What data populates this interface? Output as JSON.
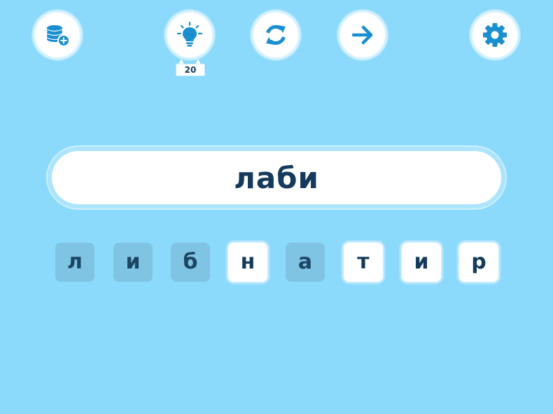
{
  "toolbar": {
    "buttons": [
      {
        "id": "coins",
        "icon": "coins-plus-icon"
      },
      {
        "id": "hint",
        "icon": "lightbulb-icon",
        "badge": "20"
      },
      {
        "id": "shuffle",
        "icon": "refresh-icon"
      },
      {
        "id": "next",
        "icon": "arrow-right-icon"
      },
      {
        "id": "settings",
        "icon": "gear-icon"
      }
    ]
  },
  "answer": {
    "text": "лаби"
  },
  "letters": [
    {
      "char": "л",
      "used": true
    },
    {
      "char": "и",
      "used": true
    },
    {
      "char": "б",
      "used": true
    },
    {
      "char": "н",
      "used": false
    },
    {
      "char": "а",
      "used": true
    },
    {
      "char": "т",
      "used": false
    },
    {
      "char": "и",
      "used": false
    },
    {
      "char": "р",
      "used": false
    }
  ],
  "colors": {
    "background": "#8bd9fb",
    "icon": "#1a8fd0",
    "text": "#153a5b",
    "tile_used": "#80c4e3"
  }
}
